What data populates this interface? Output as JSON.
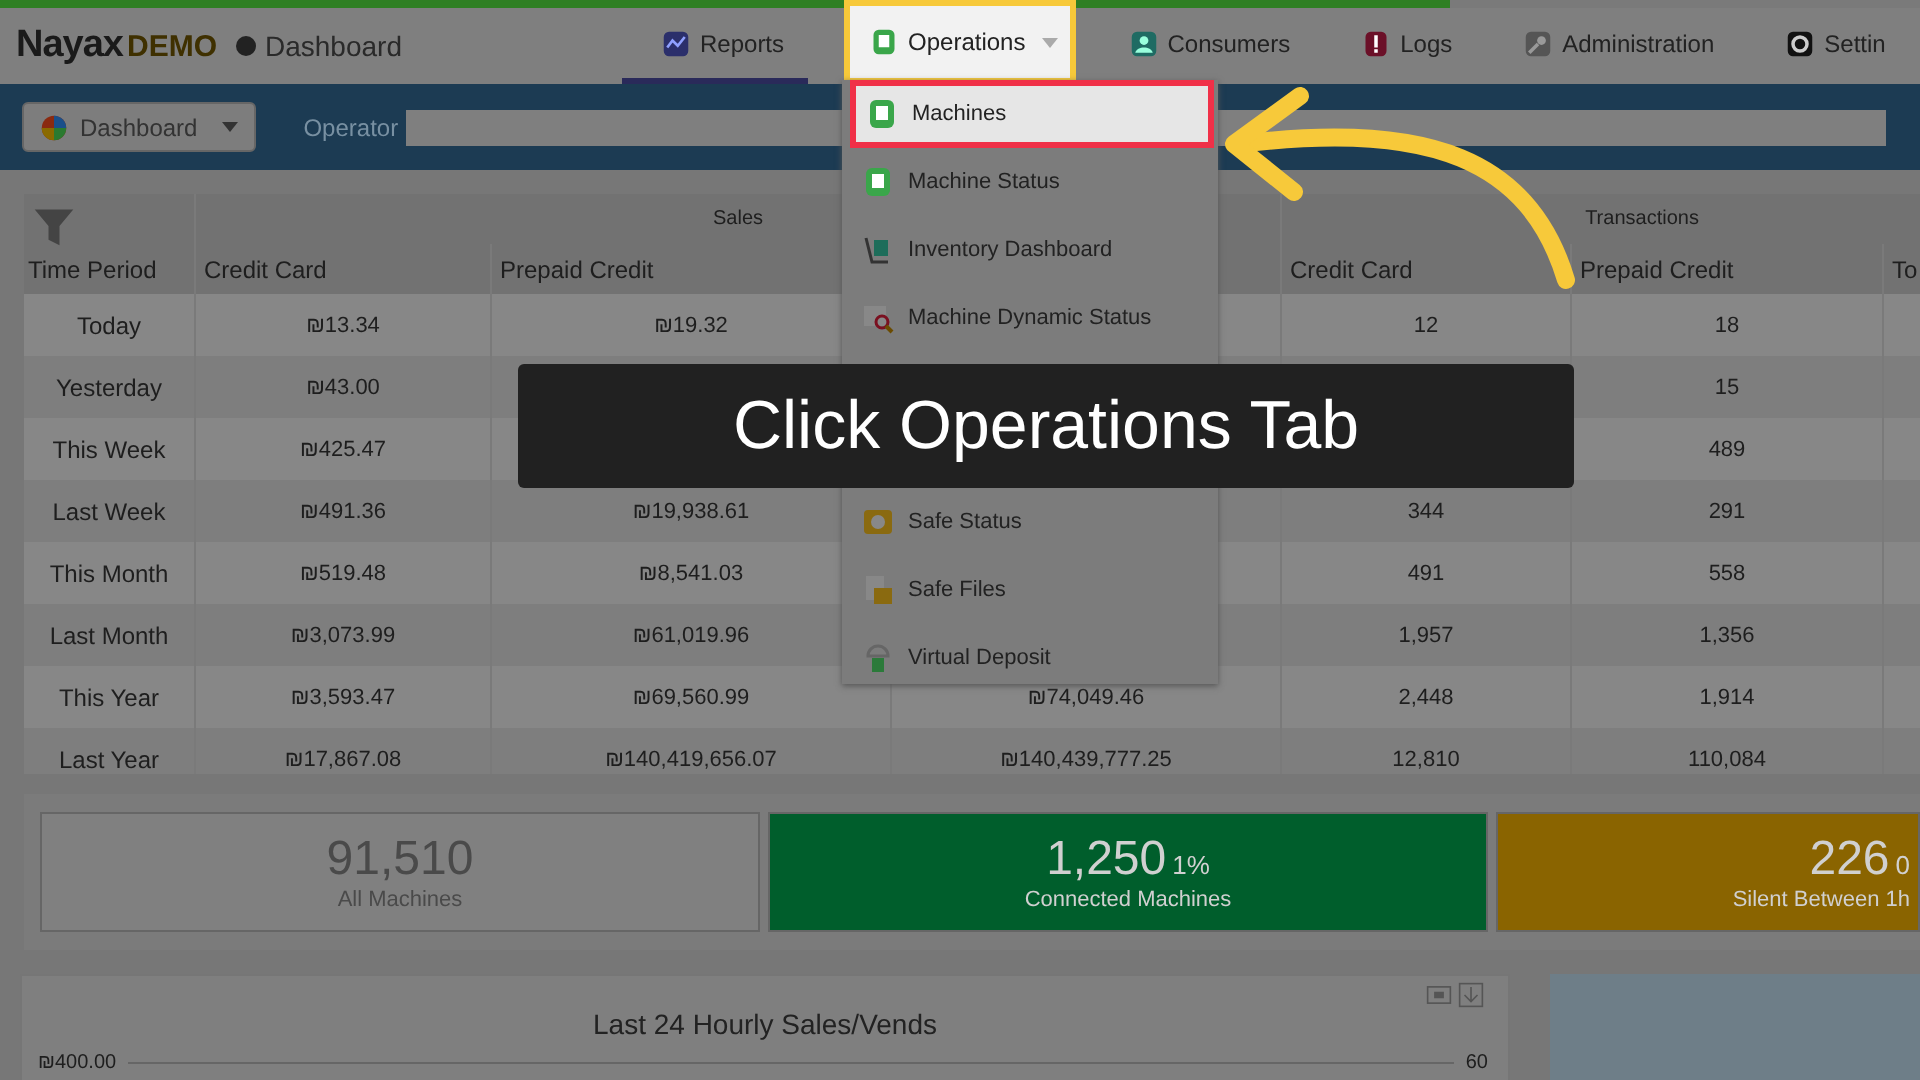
{
  "progress_bar": {
    "level": 0.755
  },
  "header": {
    "brand": "Nayax",
    "brand_suffix": "DEMO",
    "page_title": "Dashboard"
  },
  "nav_tabs": [
    {
      "label": "Reports",
      "selected": true,
      "highlighted": false,
      "dropdown": false
    },
    {
      "label": "Operations",
      "selected": false,
      "highlighted": true,
      "dropdown": true
    },
    {
      "label": "Consumers",
      "selected": false,
      "highlighted": false,
      "dropdown": false
    },
    {
      "label": "Logs",
      "selected": false,
      "highlighted": false,
      "dropdown": false
    },
    {
      "label": "Administration",
      "selected": false,
      "highlighted": false,
      "dropdown": false
    },
    {
      "label": "Settin",
      "selected": false,
      "highlighted": false,
      "dropdown": false
    }
  ],
  "toolbar": {
    "view_dropdown": "Dashboard",
    "operator_label": "Operator"
  },
  "operations_menu": {
    "items": [
      {
        "label": "Machines",
        "highlighted": true
      },
      {
        "label": "Machine Status",
        "highlighted": false
      },
      {
        "label": "Inventory Dashboard",
        "highlighted": false
      },
      {
        "label": "Machine Dynamic Status",
        "highlighted": false
      }
    ],
    "lower_items": [
      {
        "label": "Safe Status",
        "highlighted": false
      },
      {
        "label": "Safe Files",
        "highlighted": false
      },
      {
        "label": "Virtual Deposit",
        "highlighted": false
      }
    ]
  },
  "table": {
    "groups": [
      "Sales",
      "Transactions"
    ],
    "columns": [
      "Time Period",
      "Credit Card",
      "Prepaid Credit",
      null,
      "Credit Card",
      "Prepaid Credit",
      "To"
    ],
    "rows": [
      [
        "Today",
        "₪13.34",
        "₪19.32",
        null,
        "12",
        "18",
        null
      ],
      [
        "Yesterday",
        "₪43.00",
        null,
        null,
        null,
        "15",
        null
      ],
      [
        "This Week",
        "₪425.47",
        null,
        null,
        null,
        "489",
        null
      ],
      [
        "Last Week",
        "₪491.36",
        "₪19,938.61",
        null,
        "344",
        "291",
        null
      ],
      [
        "This Month",
        "₪519.48",
        "₪8,541.03",
        null,
        "491",
        "558",
        null
      ],
      [
        "Last Month",
        "₪3,073.99",
        "₪61,019.96",
        null,
        "1,957",
        "1,356",
        null
      ],
      [
        "This Year",
        "₪3,593.47",
        "₪69,560.99",
        "₪74,049.46",
        "2,448",
        "1,914",
        null
      ],
      [
        "Last Year",
        "₪17,867.08",
        "₪140,419,656.07",
        "₪140,439,777.25",
        "12,810",
        "110,084",
        null
      ]
    ]
  },
  "stat_cards": [
    {
      "value": "91,510",
      "label": "All Machines",
      "color": "#808080"
    },
    {
      "value": "1,250",
      "percent": "1%",
      "label": "Connected Machines",
      "color": "#005e2c"
    },
    {
      "value": "226",
      "percent": "0",
      "label": "Silent Between 1h",
      "color": "#8a6400"
    }
  ],
  "chart_panel": {
    "title": "Last 24 Hourly Sales/Vends",
    "left_axis_label": "₪400.00",
    "right_axis_label": "60"
  },
  "caption": "Click Operations Tab"
}
